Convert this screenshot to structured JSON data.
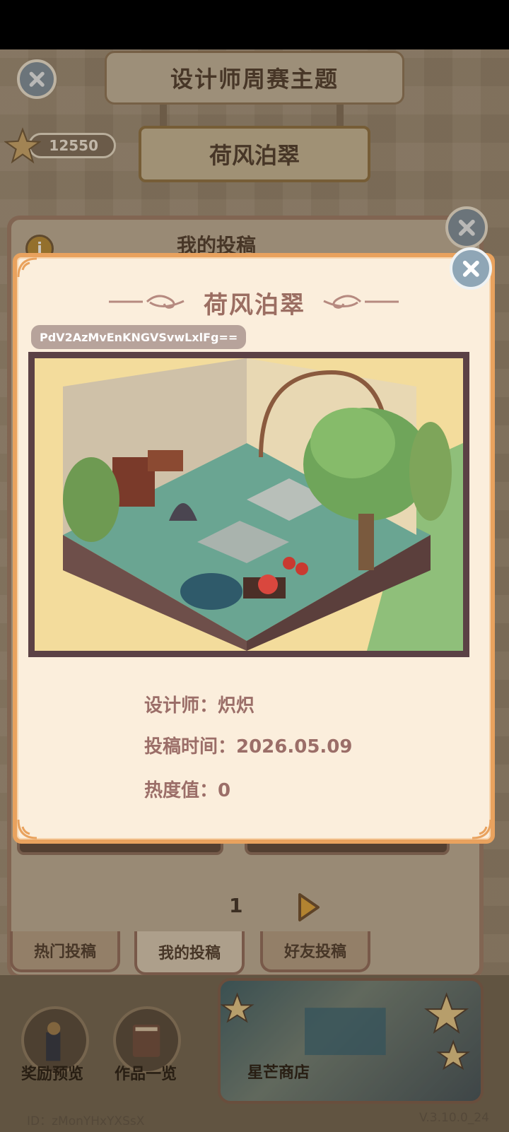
{
  "header": {
    "title": "设计师周赛主题",
    "theme": "荷风泊翠",
    "star_count": "12550"
  },
  "under_panel": {
    "title": "我的投稿",
    "page_number": "1"
  },
  "tabs": [
    {
      "label": "热门投稿",
      "active": false
    },
    {
      "label": "我的投稿",
      "active": true
    },
    {
      "label": "好友投稿",
      "active": false
    }
  ],
  "bottom": {
    "reward_preview": "奖励预览",
    "works_list": "作品一览",
    "shop": "星芒商店",
    "user_id": "ID：zMonYHxYXSsX",
    "version": "V.3.10.0_24"
  },
  "modal": {
    "title": "荷风泊翠",
    "code": "PdV2AzMvEnKNGVSvwLxlFg==",
    "designer_line": "设计师：炽炽",
    "submit_time_line": "投稿时间：2026.05.09",
    "heat_line": "热度值：0"
  },
  "colors": {
    "modal_border": "#e9a25e",
    "modal_bg": "#fbeedc",
    "info_text": "#9b6e68",
    "title_text": "#9b6e62"
  }
}
